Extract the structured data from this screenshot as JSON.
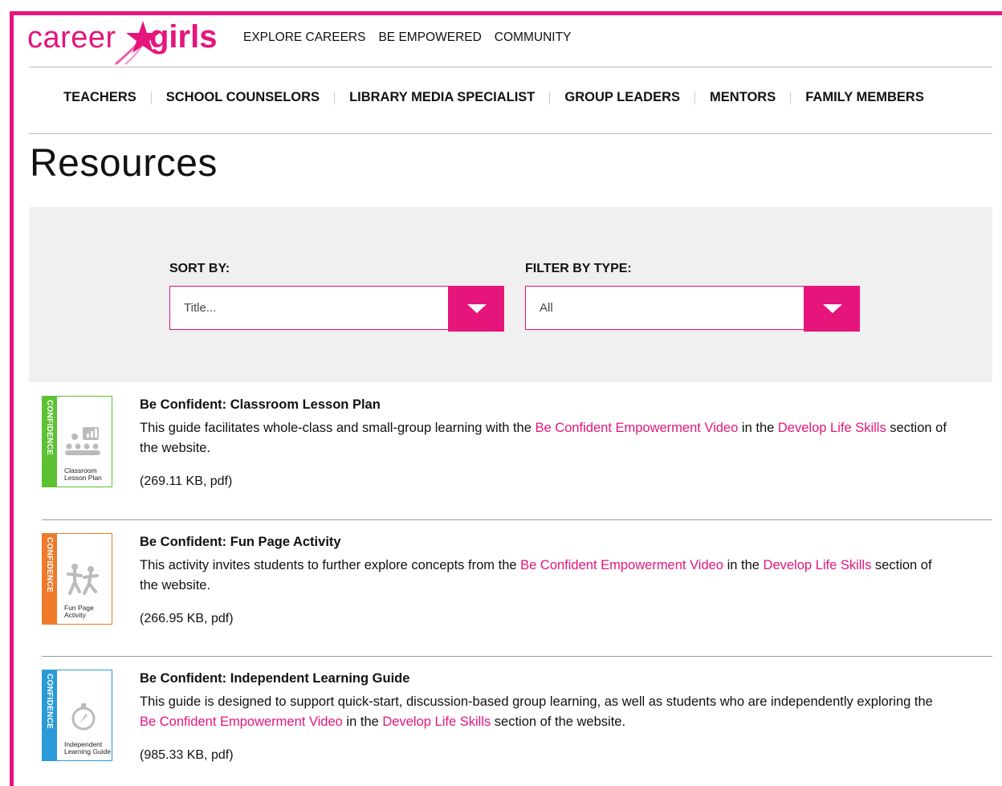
{
  "logo": {
    "part1": "career",
    "part2": "girls"
  },
  "top_nav": [
    "EXPLORE CAREERS",
    "BE EMPOWERED",
    "COMMUNITY"
  ],
  "role_nav": [
    "TEACHERS",
    "SCHOOL COUNSELORS",
    "LIBRARY MEDIA SPECIALIST",
    "GROUP LEADERS",
    "MENTORS",
    "FAMILY MEMBERS"
  ],
  "page_title": "Resources",
  "filters": {
    "sort_label": "SORT BY:",
    "sort_value": "Title...",
    "type_label": "FILTER BY TYPE:",
    "type_value": "All"
  },
  "resources": [
    {
      "title": "Be Confident: Classroom Lesson Plan",
      "desc_pre": "This guide facilitates whole-class and small-group learning with the ",
      "link1": "Be Confident Empowerment Video",
      "desc_mid": " in the ",
      "link2": "Develop Life Skills",
      "desc_post": " section of the website.",
      "size": "(269.11 KB, pdf)",
      "thumb_band": "CONFIDENCE",
      "thumb_caption": "Classroom Lesson Plan",
      "color": "#5cc234"
    },
    {
      "title": "Be Confident: Fun Page Activity",
      "desc_pre": "This activity invites students to further explore concepts from the ",
      "link1": "Be Confident Empowerment Video",
      "desc_mid": " in the ",
      "link2": "Develop Life Skills",
      "desc_post": " section of the website.",
      "size": "(266.95 KB, pdf)",
      "thumb_band": "CONFIDENCE",
      "thumb_caption": "Fun Page Activity",
      "color": "#ee7a2a"
    },
    {
      "title": "Be Confident: Independent Learning Guide",
      "desc_pre": "This guide is designed to support quick-start, discussion-based group learning, as well as students who are independently exploring the ",
      "link1": "Be Confident Empowerment Video",
      "desc_mid": " in the ",
      "link2": "Develop Life Skills",
      "desc_post": " section of the website.",
      "size": "(985.33 KB, pdf)",
      "thumb_band": "CONFIDENCE",
      "thumb_caption": "Independent Learning Guide",
      "color": "#2a9ad8"
    }
  ],
  "colors": {
    "brand": "#e5157c",
    "filter_bg": "#f0f0f0"
  }
}
